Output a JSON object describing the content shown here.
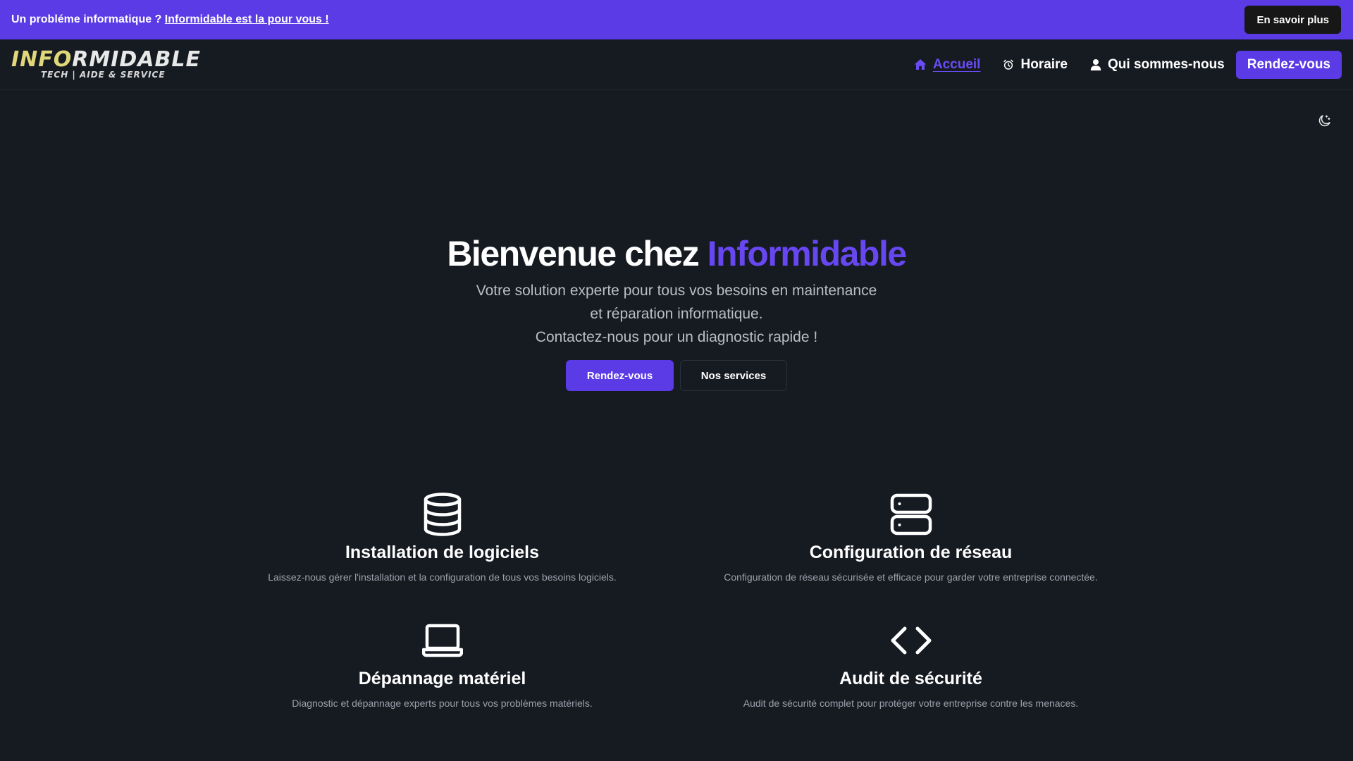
{
  "announcement": {
    "text": "Un probléme informatique ?",
    "link": "Informidable est la pour vous !",
    "button": "En savoir plus"
  },
  "logo": {
    "part1": "INFO",
    "part2": "RMIDABLE",
    "tagline": "TECH | AIDE & SERVICE"
  },
  "nav": {
    "items": [
      {
        "label": "Accueil",
        "icon": "home-icon",
        "active": true
      },
      {
        "label": "Horaire",
        "icon": "alarm-clock-icon"
      },
      {
        "label": "Qui sommes-nous",
        "icon": "user-icon"
      }
    ],
    "cta": "Rendez-vous"
  },
  "hero": {
    "title_prefix": "Bienvenue chez",
    "title_accent": "Informidable",
    "subtitle_lines": [
      "Votre solution experte pour tous vos besoins en maintenance",
      "et réparation informatique.",
      "Contactez-nous pour un diagnostic rapide !"
    ],
    "primary_button": "Rendez-vous",
    "secondary_button": "Nos services"
  },
  "services": [
    {
      "icon": "database-icon",
      "title": "Installation de logiciels",
      "description": "Laissez-nous gérer l'installation et la configuration de tous vos besoins logiciels."
    },
    {
      "icon": "server-icon",
      "title": "Configuration de réseau",
      "description": "Configuration de réseau sécurisée et efficace pour garder votre entreprise connectée."
    },
    {
      "icon": "laptop-icon",
      "title": "Dépannage matériel",
      "description": "Diagnostic et dépannage experts pour tous vos problèmes matériels."
    },
    {
      "icon": "code-icon",
      "title": "Audit de sécurité",
      "description": "Audit de sécurité complet pour protéger votre entreprise contre les menaces."
    }
  ],
  "colors": {
    "accent": "#5a3be6",
    "background": "#161b22",
    "logo_yellow": "#e0d77b"
  }
}
